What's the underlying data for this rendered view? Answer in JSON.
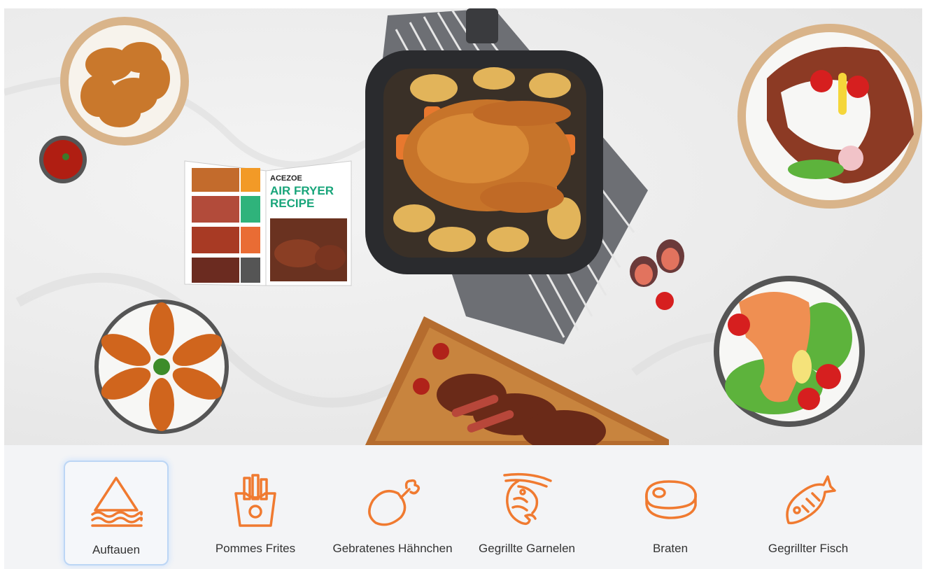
{
  "hero": {
    "recipe_book_brand": "ACEZOE",
    "recipe_book_title_line1": "AIR FRYER",
    "recipe_book_title_line2": "RECIPE"
  },
  "accent_color": "#f07a30",
  "selected_color": "#bcd6f5",
  "modes": [
    {
      "label": "Auftauen",
      "icon": "defrost-icon",
      "selected": true
    },
    {
      "label": "Pommes Frites",
      "icon": "fries-icon",
      "selected": false
    },
    {
      "label": "Gebratenes Hähnchen",
      "icon": "chicken-leg-icon",
      "selected": false
    },
    {
      "label": "Gegrillte Garnelen",
      "icon": "shrimp-icon",
      "selected": false
    },
    {
      "label": "Braten",
      "icon": "steak-icon",
      "selected": false
    },
    {
      "label": "Gegrillter Fisch",
      "icon": "fish-icon",
      "selected": false
    }
  ]
}
